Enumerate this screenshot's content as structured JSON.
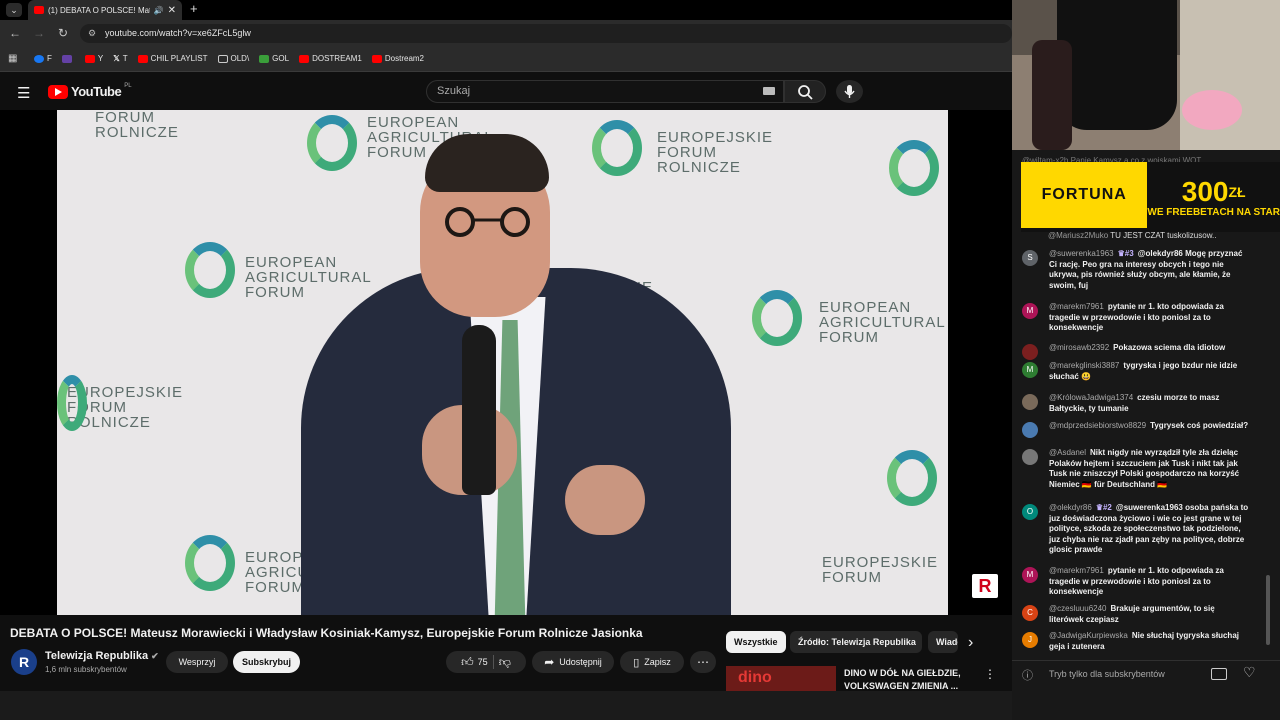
{
  "browser": {
    "tab_title": "(1) DEBATA O POLSCE! Mat",
    "url": "youtube.com/watch?v=xe6ZFcL5glw",
    "bookmarks": [
      {
        "label": "F",
        "color": "#1877f2"
      },
      {
        "label": "",
        "color": "#6441a5"
      },
      {
        "label": "Y",
        "color": "#ff0000"
      },
      {
        "label": "T",
        "color": "#ffffff"
      },
      {
        "label": "CHIL PLAYLIST",
        "color": "#ff0000"
      },
      {
        "label": "OLD\\",
        "color": "#cccccc"
      },
      {
        "label": "GOL",
        "color": "#3a9e3a"
      },
      {
        "label": "DOSTREAM1",
        "color": "#ff0000"
      },
      {
        "label": "Dostream2",
        "color": "#ff0000"
      }
    ]
  },
  "youtube": {
    "logo_text": "YouTube",
    "logo_region": "PL",
    "search_placeholder": "Szukaj"
  },
  "video": {
    "banner_text_1": "EUROPEJSKIE",
    "banner_text_2": "FORUM",
    "banner_text_3": "ROLNICZE",
    "banner_text_en_1": "EUROPEAN",
    "banner_text_en_2": "AGRICULTURAL",
    "banner_text_en_3": "FORUM",
    "channel_bug": "R",
    "title": "DEBATA O POLSCE! Mateusz Morawiecki i Władysław Kosiniak-Kamysz, Europejskie Forum Rolnicze Jasionka"
  },
  "channel": {
    "avatar_letter": "R",
    "name": "Telewizja Republika",
    "subscribers": "1,6 mln subskrybentów",
    "support_label": "Wesprzyj",
    "subscribe_label": "Subskrybuj"
  },
  "actions": {
    "like_count": "75",
    "share_label": "Udostępnij",
    "save_label": "Zapisz"
  },
  "chips": {
    "all": "Wszystkie",
    "source": "Źródło: Telewizja Republika",
    "news": "Wiadomości"
  },
  "recommendation": {
    "title_line1": "DINO W DÓŁ NA GIEŁDZIE,",
    "title_line2": "VOLKSWAGEN ZMIENIA ...",
    "thumb_text": "dino"
  },
  "stream_overlay": {
    "fortuna_brand": "FORTUNA",
    "fortuna_amount": "300",
    "fortuna_currency": "ZŁ",
    "fortuna_sub": "WE FREEBETACH NA STAR"
  },
  "chat": {
    "top_partial_user": "@wiltam-x2b",
    "top_partial_text": "Panie Kamysz a co z wojskami WOT",
    "partial_user": "@Mariusz2Muko",
    "partial_text": "TU JEST CZAT tuskolizusow..",
    "messages": [
      {
        "avatar": "S",
        "color": "#5f6368",
        "user": "@suwerenka1963",
        "badge": "♛#3",
        "text": "@olekdyr86 Mogę przyznać Ci rację. Peo gra na interesy obcych i tego nie ukrywa, pis również służy obcym, ale kłamie, że swoim, fuj"
      },
      {
        "avatar": "M",
        "color": "#ad1457",
        "user": "@marekm7961",
        "badge": "",
        "text": "pytanie nr 1. kto odpowiada za tragedie w przewodowie i kto poniosl za to konsekwencje"
      },
      {
        "avatar": "",
        "color": "#7b1f1f",
        "user": "@mirosawb2392",
        "badge": "",
        "text": "Pokazowa sciema dla idiotow"
      },
      {
        "avatar": "M",
        "color": "#2e7d32",
        "user": "@marekglinski3887",
        "badge": "",
        "text": "tygryska i jego bzdur nie idzie słuchać 😃"
      },
      {
        "avatar": "",
        "color": "#7a6a5a",
        "user": "@KrólowaJadwiga1374",
        "badge": "",
        "text": "czesiu morze to masz Bałtyckie, ty tumanie"
      },
      {
        "avatar": "",
        "color": "#4a7ab0",
        "user": "@mdprzedsiebiorstwo8829",
        "badge": "",
        "text": "Tygrysek coś powiedział?"
      },
      {
        "avatar": "",
        "color": "#777777",
        "user": "@Asdanel",
        "badge": "",
        "text": "Nikt nigdy nie wyrządził tyle zła dzieląc Polaków hejtem i szczuciem jak Tusk i nikt tak jak Tusk nie zniszczył Polski gospodarczo na korzyść Niemiec 🇩🇪 für Deutschland 🇩🇪"
      },
      {
        "avatar": "O",
        "color": "#00897b",
        "user": "@olekdyr86",
        "badge": "♛#2",
        "text": "@suwerenka1963 osoba pańska to juz doświadczona życiowo i wie co jest grane w tej polityce, szkoda ze społeczenstwo tak podzielone, juz chyba nie raz zjadł pan zęby na polityce, dobrze glosic prawde"
      },
      {
        "avatar": "M",
        "color": "#ad1457",
        "user": "@marekm7961",
        "badge": "",
        "text": "pytanie nr 1. kto odpowiada za tragedie w przewodowie i kto poniosl za to konsekwencje"
      },
      {
        "avatar": "C",
        "color": "#d84315",
        "user": "@czesluuu6240",
        "badge": "",
        "text": "Brakuje argumentów, to się literówek czepiasz"
      },
      {
        "avatar": "J",
        "color": "#e67c00",
        "user": "@JadwigaKurpiewska",
        "badge": "",
        "text": "Nie słuchaj tygryska słuchaj geja i zutenera"
      }
    ],
    "mode_text": "Tryb tylko dla subskrybentów"
  }
}
